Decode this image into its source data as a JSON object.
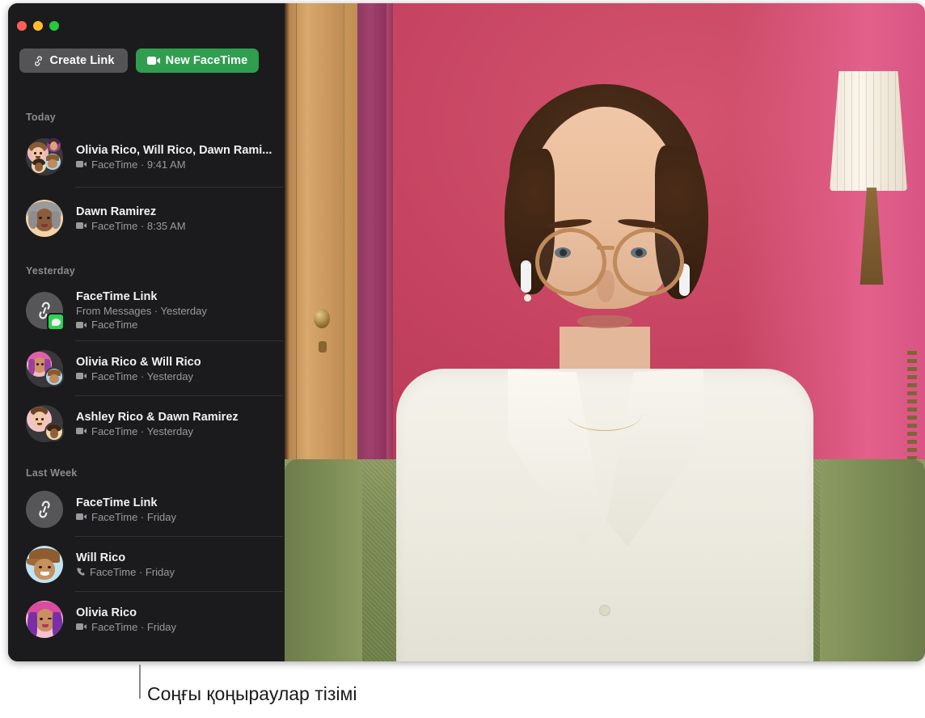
{
  "window": {
    "traffic_lights": [
      {
        "name": "close",
        "color": "#ff5f57"
      },
      {
        "name": "minimize",
        "color": "#febc2e"
      },
      {
        "name": "zoom",
        "color": "#28c840"
      }
    ]
  },
  "toolbar": {
    "create_link_label": "Create Link",
    "create_link_icon": "link-icon",
    "new_facetime_label": "New FaceTime",
    "new_facetime_icon": "video-camera-icon",
    "create_link_color": "#545456",
    "new_facetime_color": "#2f9e4f"
  },
  "sidebar": {
    "groups": [
      {
        "header": "Today",
        "items": [
          {
            "title": "Olivia Rico, Will Rico, Dawn Rami...",
            "subtitle": "FaceTime · 9:41 AM",
            "call_icon": "video-camera-icon",
            "avatar": "group-avatar-four"
          },
          {
            "title": "Dawn Ramirez",
            "subtitle": "FaceTime · 8:35 AM",
            "call_icon": "video-camera-icon",
            "avatar": "memoji-dawn"
          }
        ]
      },
      {
        "header": "Yesterday",
        "items": [
          {
            "title": "FaceTime Link",
            "source": "From Messages · Yesterday",
            "subtitle": "FaceTime",
            "call_icon": "video-camera-icon",
            "avatar": "link-icon-with-messages-badge"
          },
          {
            "title": "Olivia Rico & Will Rico",
            "subtitle": "FaceTime · Yesterday",
            "call_icon": "video-camera-icon",
            "avatar": "group-avatar-two-olivia-will"
          },
          {
            "title": "Ashley Rico & Dawn Ramirez",
            "subtitle": "FaceTime · Yesterday",
            "call_icon": "video-camera-icon",
            "avatar": "group-avatar-two-ashley-dawn"
          }
        ]
      },
      {
        "header": "Last Week",
        "items": [
          {
            "title": "FaceTime Link",
            "subtitle": "FaceTime · Friday",
            "call_icon": "video-camera-icon",
            "avatar": "link-icon"
          },
          {
            "title": "Will Rico",
            "subtitle": "FaceTime · Friday",
            "call_icon": "phone-icon",
            "avatar": "memoji-will"
          },
          {
            "title": "Olivia Rico",
            "subtitle": "FaceTime · Friday",
            "call_icon": "video-camera-icon",
            "avatar": "memoji-olivia"
          }
        ]
      }
    ]
  },
  "video_pane": {
    "description": "FaceTime video of a person with curly brown hair and tortoiseshell glasses wearing AirPods, a white shirt over a blue t-shirt, seated on a green couch in front of a pink wall beside a wooden door and a lamp"
  },
  "caption": {
    "text": "Соңғы қоңыраулар тізімі"
  }
}
